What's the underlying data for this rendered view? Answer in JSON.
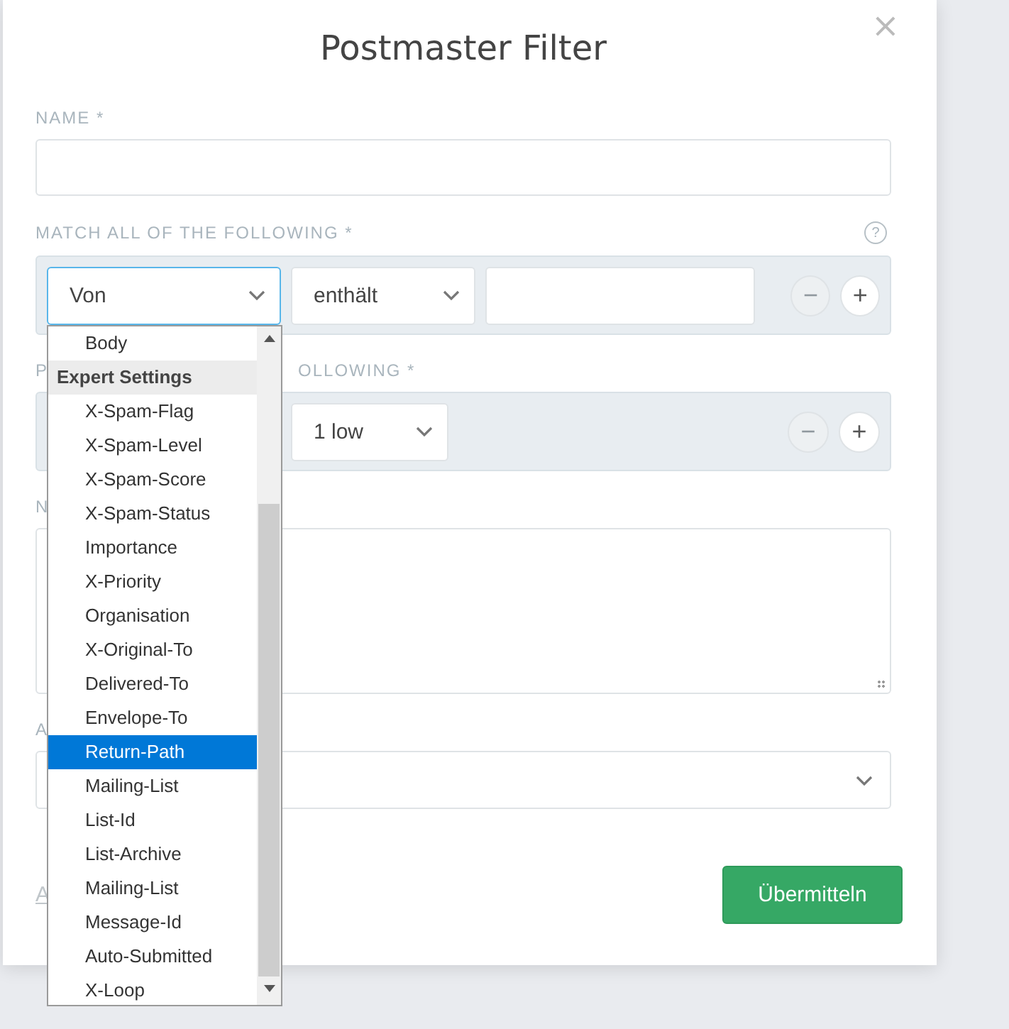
{
  "dialog": {
    "title": "Postmaster Filter",
    "close": "×"
  },
  "name_field": {
    "label": "NAME *"
  },
  "match": {
    "label": "MATCH ALL OF THE FOLLOWING *",
    "help": "?",
    "conditions": [
      {
        "field": "Von",
        "operator": "enthält",
        "focused": true,
        "buttons": [
          {
            "symbol": "−",
            "disabled": true
          },
          {
            "symbol": "+",
            "disabled": false
          }
        ]
      }
    ]
  },
  "dropdown": {
    "items": [
      {
        "kind": "option",
        "label": "Body",
        "selected": false
      },
      {
        "kind": "group",
        "label": "Expert Settings"
      },
      {
        "kind": "option",
        "label": "X-Spam-Flag",
        "selected": false
      },
      {
        "kind": "option",
        "label": "X-Spam-Level",
        "selected": false
      },
      {
        "kind": "option",
        "label": "X-Spam-Score",
        "selected": false
      },
      {
        "kind": "option",
        "label": "X-Spam-Status",
        "selected": false
      },
      {
        "kind": "option",
        "label": "Importance",
        "selected": false
      },
      {
        "kind": "option",
        "label": "X-Priority",
        "selected": false
      },
      {
        "kind": "option",
        "label": "Organisation",
        "selected": false
      },
      {
        "kind": "option",
        "label": "X-Original-To",
        "selected": false
      },
      {
        "kind": "option",
        "label": "Delivered-To",
        "selected": false
      },
      {
        "kind": "option",
        "label": "Envelope-To",
        "selected": false
      },
      {
        "kind": "option",
        "label": "Return-Path",
        "selected": true
      },
      {
        "kind": "option",
        "label": "Mailing-List",
        "selected": false
      },
      {
        "kind": "option",
        "label": "List-Id",
        "selected": false
      },
      {
        "kind": "option",
        "label": "List-Archive",
        "selected": false
      },
      {
        "kind": "option",
        "label": "Mailing-List",
        "selected": false
      },
      {
        "kind": "option",
        "label": "Message-Id",
        "selected": false
      },
      {
        "kind": "option",
        "label": "Auto-Submitted",
        "selected": false
      },
      {
        "kind": "option",
        "label": "X-Loop",
        "selected": false
      }
    ]
  },
  "perform": {
    "label_start": "P",
    "label_end": "OLLOWING *",
    "actions": [
      {
        "value": "1 low",
        "buttons": [
          {
            "symbol": "−",
            "disabled": true
          },
          {
            "symbol": "+",
            "disabled": false
          }
        ]
      }
    ]
  },
  "note": {
    "label_start": "N"
  },
  "group": {
    "label_start": "A"
  },
  "footer": {
    "link": "A",
    "submit": "Übermitteln"
  }
}
